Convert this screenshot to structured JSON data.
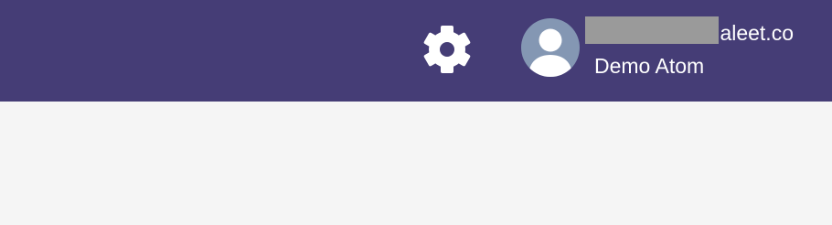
{
  "header": {
    "background_color": "#453d76",
    "settings": {
      "icon": "gear-icon",
      "color": "#ffffff"
    },
    "user": {
      "avatar_icon": "user-avatar-icon",
      "avatar_color": "#8497b3",
      "email_visible": "aleet.co",
      "email_redacted": true,
      "name": "Demo Atom"
    }
  },
  "content": {
    "background_color": "#f5f5f5"
  }
}
